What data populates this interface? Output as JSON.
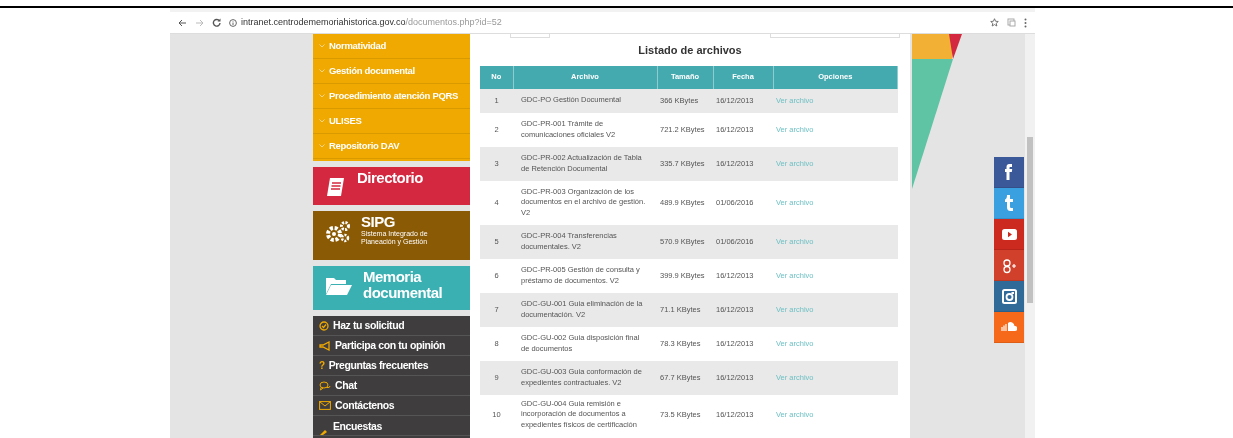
{
  "browser": {
    "url_host": "intranet.centrodememoriahistorica.gov.co",
    "url_path": "/documentos.php?id=52"
  },
  "sidebar": {
    "menu": [
      {
        "label": "Normatividad"
      },
      {
        "label": "Gestión documental"
      },
      {
        "label": "Procedimiento atención PQRS"
      },
      {
        "label": "ULISES"
      },
      {
        "label": "Repositorio DAV"
      }
    ],
    "tiles": [
      {
        "kind": "directory",
        "title": "Directorio",
        "color": "#d3283f"
      },
      {
        "kind": "sipg",
        "title": "SIPG",
        "subtitle": "Sistema Integrado de Planeación y Gestión",
        "color": "#8a5a05"
      },
      {
        "kind": "memory",
        "title": "Memoria documental",
        "color": "#3bb0b3"
      }
    ],
    "links": [
      {
        "kind": "check",
        "label": "Haz tu solicitud"
      },
      {
        "kind": "megaphone",
        "label": "Participa con tu opinión"
      },
      {
        "kind": "question",
        "label": "Preguntas frecuentes",
        "icon": "?"
      },
      {
        "kind": "chat",
        "label": "Chat"
      },
      {
        "kind": "mail",
        "label": "Contáctenos"
      },
      {
        "kind": "pencil",
        "label": "Encuestas"
      }
    ]
  },
  "table": {
    "title": "Listado de archivos",
    "columns": [
      "No",
      "Archivo",
      "Tamaño",
      "Fecha",
      "Opciones"
    ],
    "rows": [
      {
        "no": "1",
        "file": "GDC-PO Gestión Documental",
        "size": "366 KBytes",
        "date": "16/12/2013",
        "action": "Ver archivo"
      },
      {
        "no": "2",
        "file": "GDC-PR-001 Trámite de comunicaciones oficiales V2",
        "size": "721.2 KBytes",
        "date": "16/12/2013",
        "action": "Ver archivo"
      },
      {
        "no": "3",
        "file": "GDC-PR-002 Actualización de Tabla de Retención Documental",
        "size": "335.7 KBytes",
        "date": "16/12/2013",
        "action": "Ver archivo"
      },
      {
        "no": "4",
        "file": "GDC-PR-003 Organización de los documentos en el archivo de gestión. V2",
        "size": "489.9 KBytes",
        "date": "01/06/2016",
        "action": "Ver archivo"
      },
      {
        "no": "5",
        "file": "GDC-PR-004 Transferencias documentales. V2",
        "size": "570.9 KBytes",
        "date": "01/06/2016",
        "action": "Ver archivo"
      },
      {
        "no": "6",
        "file": "GDC-PR-005 Gestión de consulta y préstamo de documentos. V2",
        "size": "399.9 KBytes",
        "date": "16/12/2013",
        "action": "Ver archivo"
      },
      {
        "no": "7",
        "file": "GDC-GU-001 Guia eliminación de la documentación. V2",
        "size": "71.1 KBytes",
        "date": "16/12/2013",
        "action": "Ver archivo"
      },
      {
        "no": "8",
        "file": "GDC-GU-002 Guia disposición final de documentos",
        "size": "78.3 KBytes",
        "date": "16/12/2013",
        "action": "Ver archivo"
      },
      {
        "no": "9",
        "file": "GDC-GU-003 Guia conformación de expedientes contractuales. V2",
        "size": "67.7 KBytes",
        "date": "16/12/2013",
        "action": "Ver archivo"
      },
      {
        "no": "10",
        "file": "GDC-GU-004 Guia remisión e incorporación de documentos a expedientes físicos de certificación",
        "size": "73.5 KBytes",
        "date": "16/12/2013",
        "action": "Ver archivo"
      }
    ]
  },
  "social": [
    {
      "kind": "facebook",
      "color": "#3b5998"
    },
    {
      "kind": "tumblr",
      "color": "#3aa0e0"
    },
    {
      "kind": "youtube",
      "color": "#cc2a1e"
    },
    {
      "kind": "googleplus",
      "color": "#d0402a"
    },
    {
      "kind": "instagram",
      "color": "#2f6a99"
    },
    {
      "kind": "soundcloud",
      "color": "#f7691a"
    }
  ]
}
